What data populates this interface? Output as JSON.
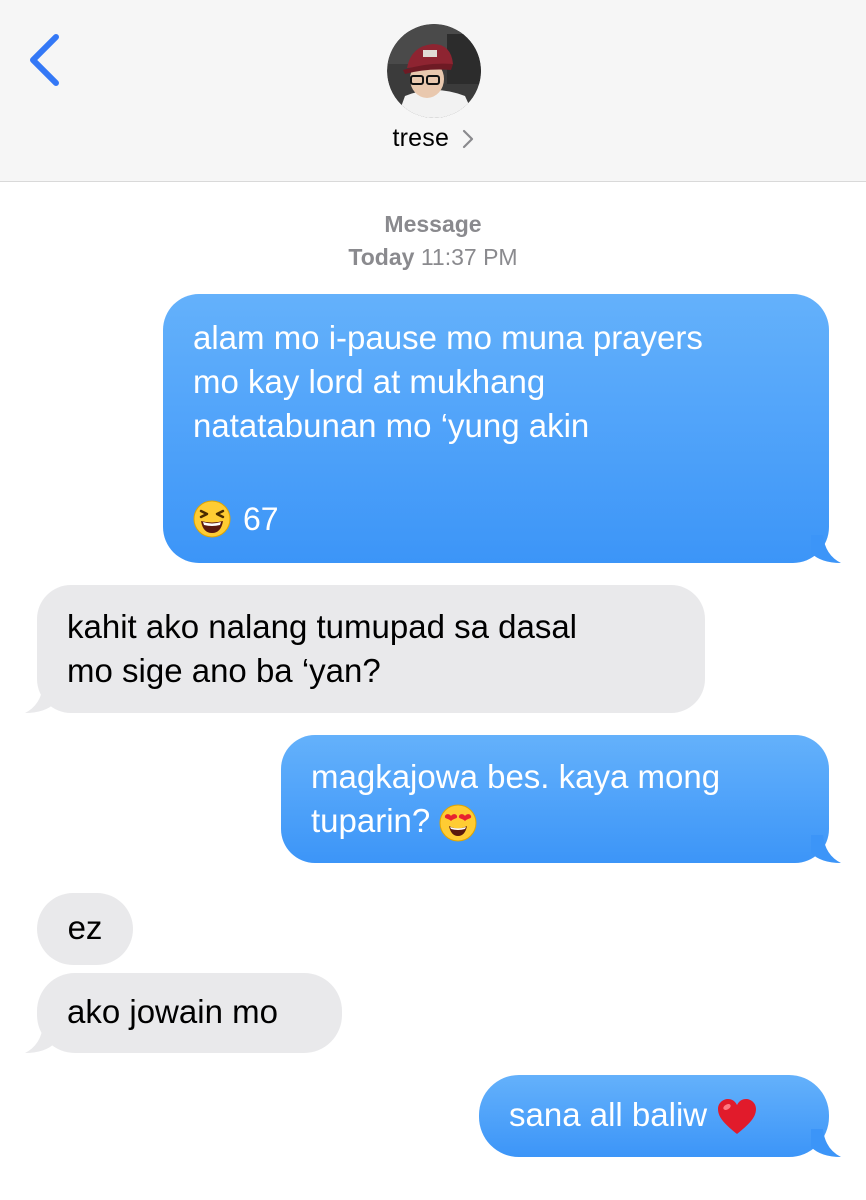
{
  "header": {
    "contact_name": "trese"
  },
  "thread": {
    "service_label": "Message",
    "day_label": "Today",
    "time_label": "11:37 PM"
  },
  "messages": [
    {
      "from": "me",
      "lines": [
        "alam mo i-pause mo muna prayers",
        "mo kay lord at mukhang",
        "natatabunan mo ‘yung akin"
      ],
      "reaction": {
        "emoji": "laughing-face",
        "count": "67"
      }
    },
    {
      "from": "them",
      "lines": [
        "kahit ako nalang tumupad sa dasal",
        "mo sige ano ba ‘yan?"
      ]
    },
    {
      "from": "me",
      "lines": [
        "magkajowa bes. kaya mong",
        "tuparin?"
      ],
      "emoji": "heart-eyes-face"
    },
    {
      "from": "them",
      "lines": [
        "ez"
      ]
    },
    {
      "from": "them",
      "lines": [
        "ako jowain mo"
      ]
    },
    {
      "from": "me",
      "lines": [
        "sana all baliw"
      ],
      "emoji": "red-heart"
    }
  ],
  "colors": {
    "accent": "#3478f6",
    "sent_bubble_top": "#64b1fb",
    "sent_bubble_bottom": "#3c95f8",
    "received_bubble": "#e9e9eb",
    "header_bg": "#f6f6f6",
    "timestamp": "#8a8a8e"
  }
}
